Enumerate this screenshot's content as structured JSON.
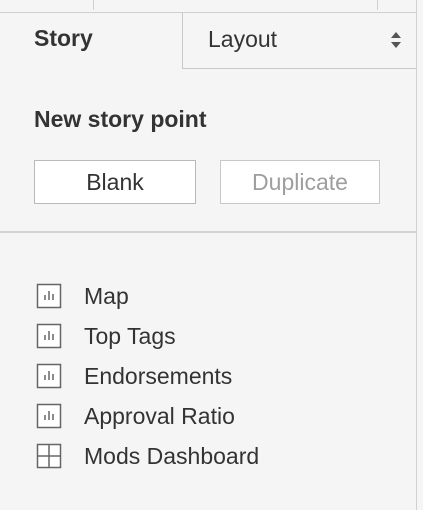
{
  "tabs": {
    "story_label": "Story",
    "layout_label": "Layout"
  },
  "new_story_point": {
    "title": "New story point",
    "blank_label": "Blank",
    "duplicate_label": "Duplicate"
  },
  "sheets": [
    {
      "label": "Map",
      "icon": "worksheet-icon"
    },
    {
      "label": "Top Tags",
      "icon": "worksheet-icon"
    },
    {
      "label": "Endorsements",
      "icon": "worksheet-icon"
    },
    {
      "label": "Approval Ratio",
      "icon": "worksheet-icon"
    },
    {
      "label": "Mods Dashboard",
      "icon": "dashboard-icon"
    }
  ],
  "colors": {
    "text": "#333333",
    "disabled_text": "#9e9e9e",
    "panel_bg": "#f5f5f5",
    "border": "#c8c8c8"
  }
}
